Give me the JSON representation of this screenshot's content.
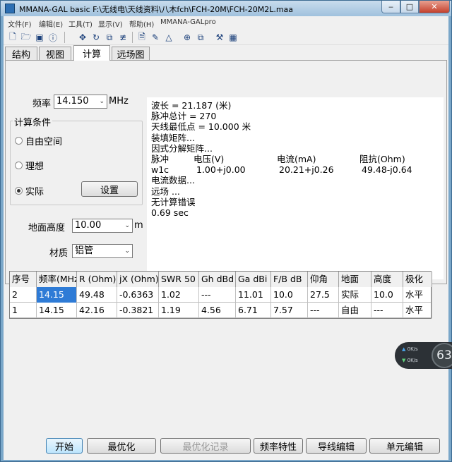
{
  "window": {
    "title": "MMANA-GAL basic F:\\无线电\\天线资料\\八木fch\\FCH-20M\\FCH-20M2L.maa",
    "minimize": "‒",
    "maximize": "□",
    "close": "✕"
  },
  "menu": [
    "文件(F)",
    "编辑(E)",
    "工具(T)",
    "显示(V)",
    "帮助(H)",
    "MMANA-GALpro"
  ],
  "toolbar_icons": [
    "new-file-icon",
    "open-folder-icon",
    "save-icon",
    "info-icon",
    "move-icon",
    "rotate-icon",
    "scale-icon",
    "wire-edit-icon",
    "document-icon",
    "edit-icon",
    "triangle-icon",
    "target-icon",
    "copy-icon",
    "tools-icon",
    "calculator-icon"
  ],
  "tabs": [
    {
      "label": "结构",
      "active": false
    },
    {
      "label": "视图",
      "active": false
    },
    {
      "label": "计算",
      "active": true
    },
    {
      "label": "远场图",
      "active": false
    }
  ],
  "calc": {
    "freq_label": "频率",
    "freq_value": "14.150",
    "freq_unit": "MHz",
    "conditions_title": "计算条件",
    "radios": [
      {
        "label": "自由空间",
        "selected": false
      },
      {
        "label": "理想",
        "selected": false
      },
      {
        "label": "实际",
        "selected": true
      }
    ],
    "settings_button": "设置",
    "ground_height_label": "地面高度",
    "ground_height_value": "10.00",
    "ground_height_unit": "m",
    "material_label": "材质",
    "material_value": "铝管"
  },
  "output": {
    "lines": [
      "波长 = 21.187 (米)",
      "脉冲总计 = 270",
      "天线最低点 = 10.000 米",
      "装填矩阵...",
      "因式分解矩阵..."
    ],
    "table_header": [
      "脉冲",
      "电压(V)",
      "电流(mA)",
      "阻抗(Ohm)"
    ],
    "table_row": [
      "w1c",
      "1.00+j0.00",
      "20.21+j0.26",
      "49.48-j0.64"
    ],
    "lines_after": [
      "电流数据...",
      "远场 ...",
      "无计算错误",
      "0.69 sec"
    ]
  },
  "results": {
    "headers": [
      "序号",
      "频率(MHz",
      "R (Ohm)",
      "jX (Ohm)",
      "SWR 50",
      "Gh dBd",
      "Ga dBi",
      "F/B dB",
      "仰角",
      "地面",
      "高度",
      "极化"
    ],
    "rows": [
      [
        "2",
        "14.15",
        "49.48",
        "-0.6363",
        "1.02",
        "---",
        "11.01",
        "10.0",
        "27.5",
        "实际",
        "10.0",
        "水平"
      ],
      [
        "1",
        "14.15",
        "42.16",
        "-0.3821",
        "1.19",
        "4.56",
        "6.71",
        "7.57",
        "---",
        "自由",
        "---",
        "水平"
      ]
    ]
  },
  "buttons": [
    "开始",
    "最优化",
    "最优化记录",
    "频率特性",
    "导线编辑",
    "单元编辑"
  ],
  "net_widget": {
    "up": "0K/s",
    "down": "0K/s",
    "value": "63"
  }
}
